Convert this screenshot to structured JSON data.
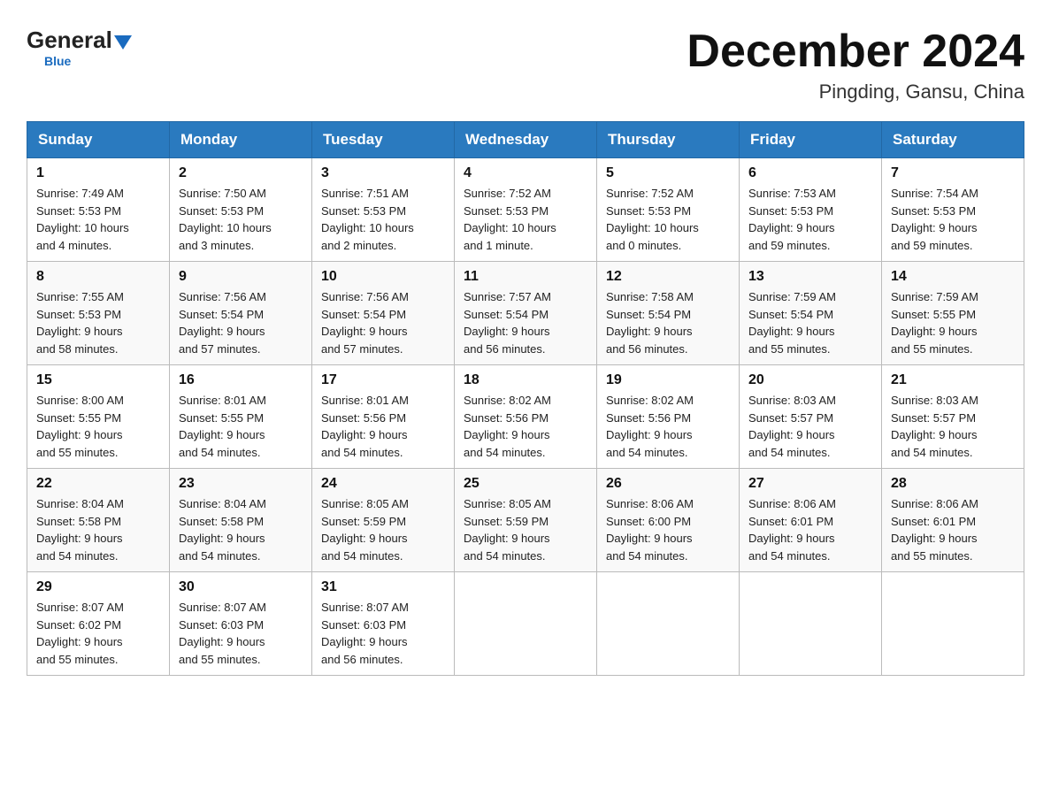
{
  "header": {
    "logo": {
      "general": "General",
      "blue": "Blue"
    },
    "title": "December 2024",
    "location": "Pingding, Gansu, China"
  },
  "weekdays": [
    "Sunday",
    "Monday",
    "Tuesday",
    "Wednesday",
    "Thursday",
    "Friday",
    "Saturday"
  ],
  "weeks": [
    [
      {
        "day": "1",
        "sunrise": "7:49 AM",
        "sunset": "5:53 PM",
        "daylight": "10 hours and 4 minutes."
      },
      {
        "day": "2",
        "sunrise": "7:50 AM",
        "sunset": "5:53 PM",
        "daylight": "10 hours and 3 minutes."
      },
      {
        "day": "3",
        "sunrise": "7:51 AM",
        "sunset": "5:53 PM",
        "daylight": "10 hours and 2 minutes."
      },
      {
        "day": "4",
        "sunrise": "7:52 AM",
        "sunset": "5:53 PM",
        "daylight": "10 hours and 1 minute."
      },
      {
        "day": "5",
        "sunrise": "7:52 AM",
        "sunset": "5:53 PM",
        "daylight": "10 hours and 0 minutes."
      },
      {
        "day": "6",
        "sunrise": "7:53 AM",
        "sunset": "5:53 PM",
        "daylight": "9 hours and 59 minutes."
      },
      {
        "day": "7",
        "sunrise": "7:54 AM",
        "sunset": "5:53 PM",
        "daylight": "9 hours and 59 minutes."
      }
    ],
    [
      {
        "day": "8",
        "sunrise": "7:55 AM",
        "sunset": "5:53 PM",
        "daylight": "9 hours and 58 minutes."
      },
      {
        "day": "9",
        "sunrise": "7:56 AM",
        "sunset": "5:54 PM",
        "daylight": "9 hours and 57 minutes."
      },
      {
        "day": "10",
        "sunrise": "7:56 AM",
        "sunset": "5:54 PM",
        "daylight": "9 hours and 57 minutes."
      },
      {
        "day": "11",
        "sunrise": "7:57 AM",
        "sunset": "5:54 PM",
        "daylight": "9 hours and 56 minutes."
      },
      {
        "day": "12",
        "sunrise": "7:58 AM",
        "sunset": "5:54 PM",
        "daylight": "9 hours and 56 minutes."
      },
      {
        "day": "13",
        "sunrise": "7:59 AM",
        "sunset": "5:54 PM",
        "daylight": "9 hours and 55 minutes."
      },
      {
        "day": "14",
        "sunrise": "7:59 AM",
        "sunset": "5:55 PM",
        "daylight": "9 hours and 55 minutes."
      }
    ],
    [
      {
        "day": "15",
        "sunrise": "8:00 AM",
        "sunset": "5:55 PM",
        "daylight": "9 hours and 55 minutes."
      },
      {
        "day": "16",
        "sunrise": "8:01 AM",
        "sunset": "5:55 PM",
        "daylight": "9 hours and 54 minutes."
      },
      {
        "day": "17",
        "sunrise": "8:01 AM",
        "sunset": "5:56 PM",
        "daylight": "9 hours and 54 minutes."
      },
      {
        "day": "18",
        "sunrise": "8:02 AM",
        "sunset": "5:56 PM",
        "daylight": "9 hours and 54 minutes."
      },
      {
        "day": "19",
        "sunrise": "8:02 AM",
        "sunset": "5:56 PM",
        "daylight": "9 hours and 54 minutes."
      },
      {
        "day": "20",
        "sunrise": "8:03 AM",
        "sunset": "5:57 PM",
        "daylight": "9 hours and 54 minutes."
      },
      {
        "day": "21",
        "sunrise": "8:03 AM",
        "sunset": "5:57 PM",
        "daylight": "9 hours and 54 minutes."
      }
    ],
    [
      {
        "day": "22",
        "sunrise": "8:04 AM",
        "sunset": "5:58 PM",
        "daylight": "9 hours and 54 minutes."
      },
      {
        "day": "23",
        "sunrise": "8:04 AM",
        "sunset": "5:58 PM",
        "daylight": "9 hours and 54 minutes."
      },
      {
        "day": "24",
        "sunrise": "8:05 AM",
        "sunset": "5:59 PM",
        "daylight": "9 hours and 54 minutes."
      },
      {
        "day": "25",
        "sunrise": "8:05 AM",
        "sunset": "5:59 PM",
        "daylight": "9 hours and 54 minutes."
      },
      {
        "day": "26",
        "sunrise": "8:06 AM",
        "sunset": "6:00 PM",
        "daylight": "9 hours and 54 minutes."
      },
      {
        "day": "27",
        "sunrise": "8:06 AM",
        "sunset": "6:01 PM",
        "daylight": "9 hours and 54 minutes."
      },
      {
        "day": "28",
        "sunrise": "8:06 AM",
        "sunset": "6:01 PM",
        "daylight": "9 hours and 55 minutes."
      }
    ],
    [
      {
        "day": "29",
        "sunrise": "8:07 AM",
        "sunset": "6:02 PM",
        "daylight": "9 hours and 55 minutes."
      },
      {
        "day": "30",
        "sunrise": "8:07 AM",
        "sunset": "6:03 PM",
        "daylight": "9 hours and 55 minutes."
      },
      {
        "day": "31",
        "sunrise": "8:07 AM",
        "sunset": "6:03 PM",
        "daylight": "9 hours and 56 minutes."
      },
      null,
      null,
      null,
      null
    ]
  ],
  "labels": {
    "sunrise": "Sunrise:",
    "sunset": "Sunset:",
    "daylight": "Daylight:"
  }
}
